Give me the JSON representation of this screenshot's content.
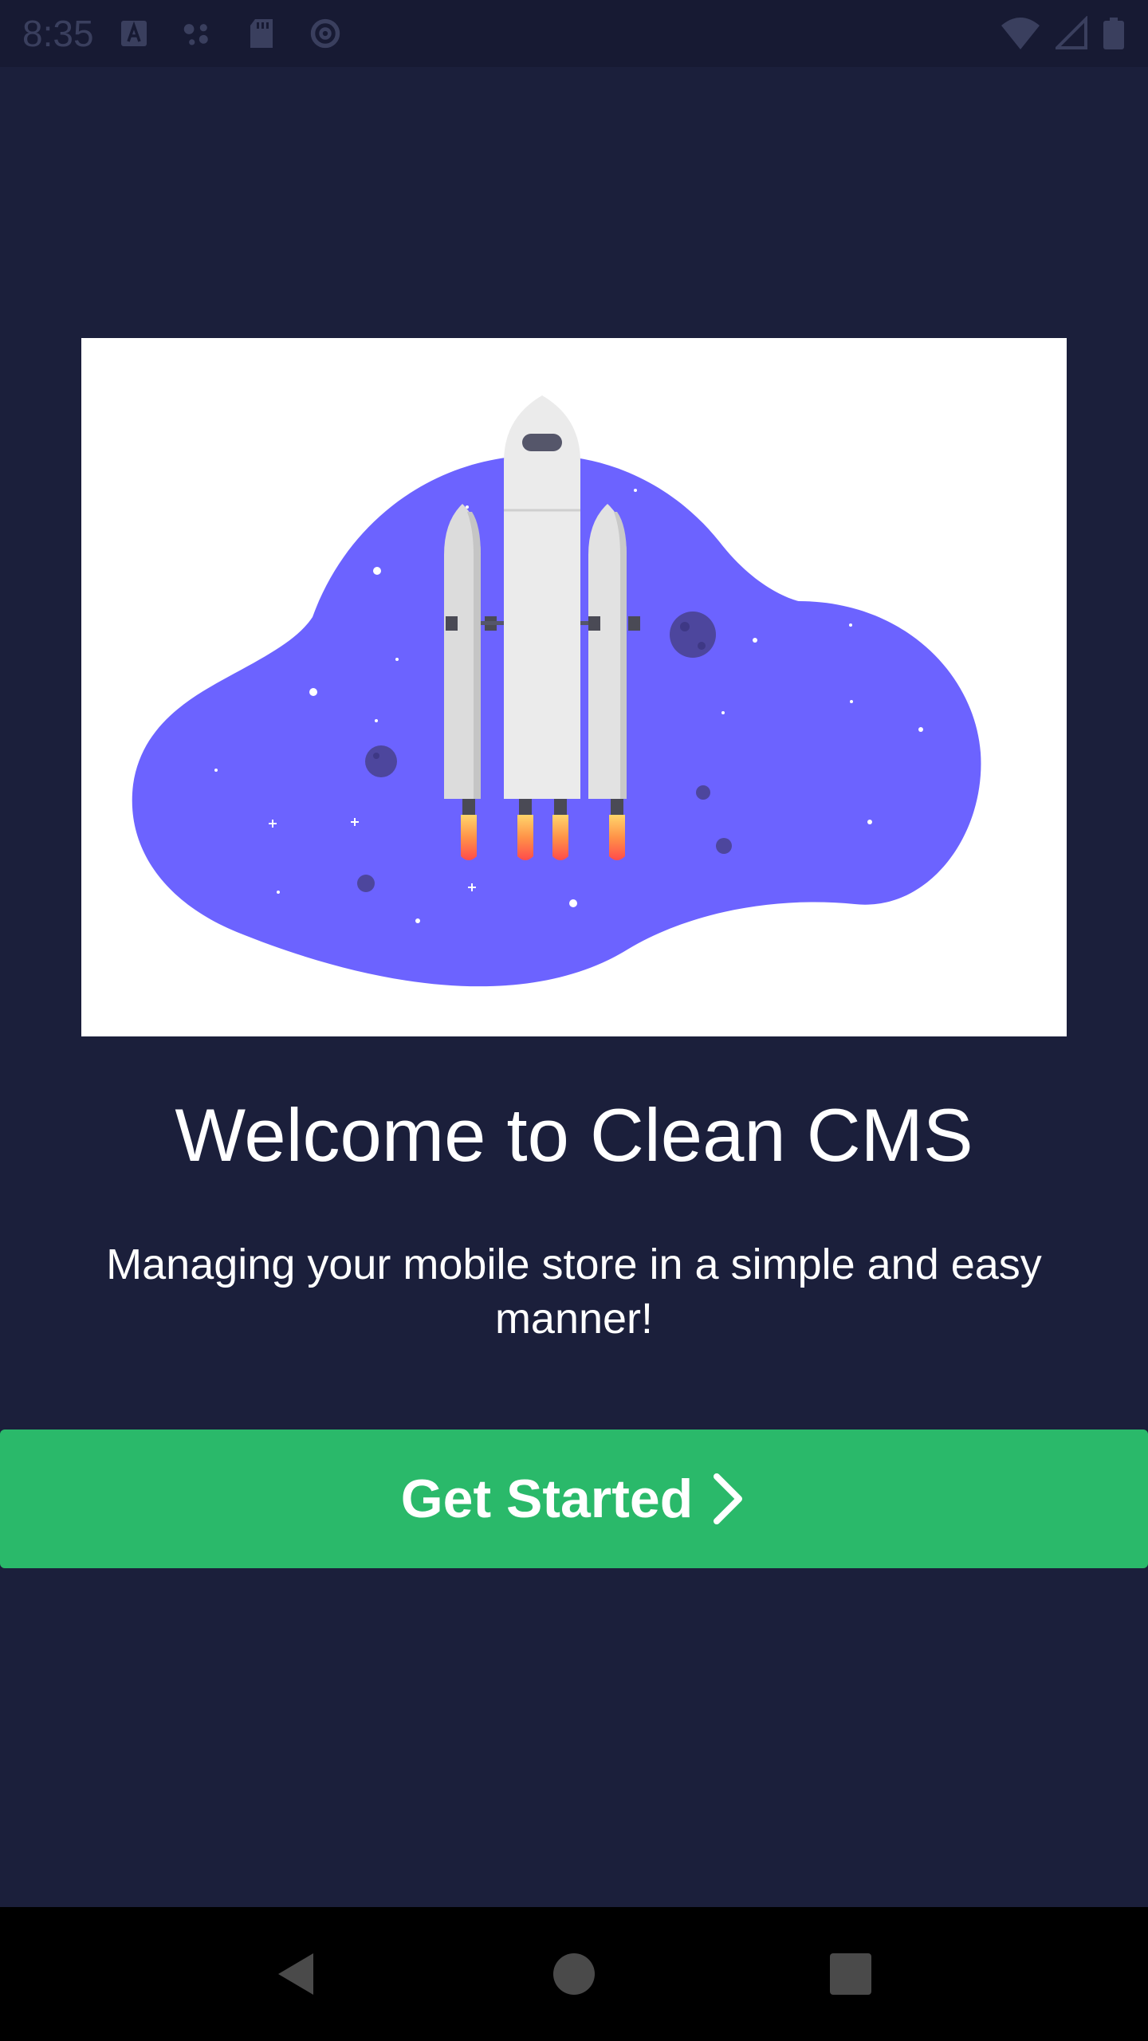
{
  "status_bar": {
    "time": "8:35",
    "left_icons": [
      "app-a-icon",
      "assistant-dots-icon",
      "sd-card-icon",
      "at-sign-icon"
    ],
    "right_icons": [
      "wifi-icon",
      "signal-icon",
      "battery-icon"
    ]
  },
  "onboarding": {
    "illustration": "rocket-launch-illustration",
    "title": "Welcome to Clean CMS",
    "subtitle": "Managing your mobile store in a simple and easy manner!",
    "cta_label": "Get Started",
    "cta_icon": "chevron-right-icon"
  },
  "nav_bar": {
    "buttons": [
      "back-icon",
      "home-icon",
      "recents-icon"
    ]
  },
  "colors": {
    "background": "#1b1f3b",
    "accent_green": "#2ab96a",
    "blob_purple": "#6c63ff"
  }
}
